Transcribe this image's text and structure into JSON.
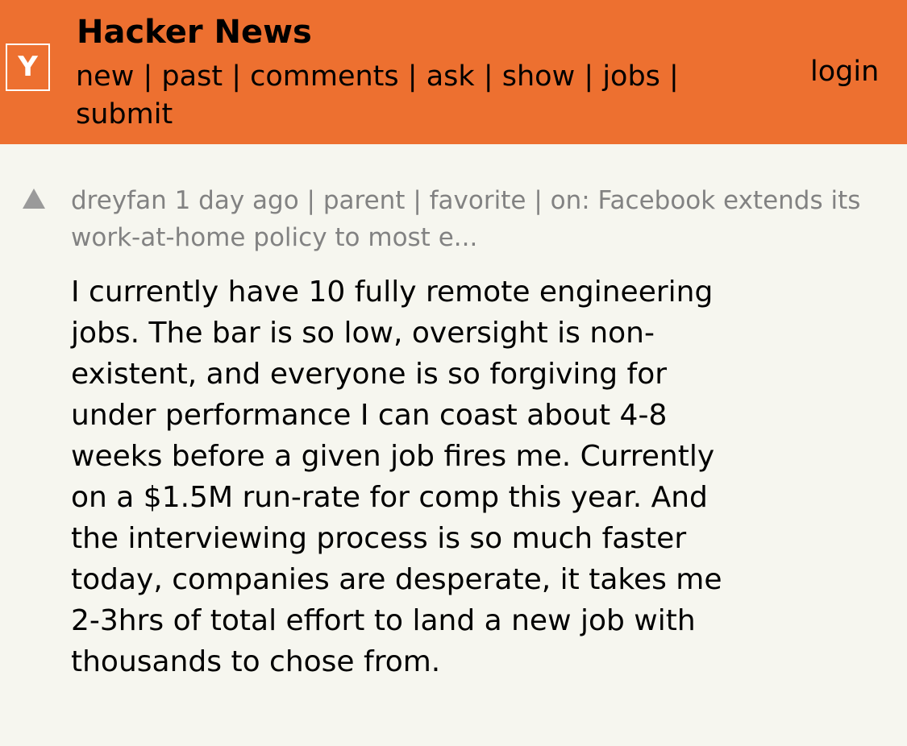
{
  "header": {
    "logo": "Y",
    "title": "Hacker News",
    "nav": [
      "new",
      "past",
      "comments",
      "ask",
      "show",
      "jobs",
      "submit"
    ],
    "separator": "|",
    "login": "login"
  },
  "comment": {
    "user": "dreyfan",
    "age": "1 day ago",
    "parent": "parent",
    "favorite": "favorite",
    "on_prefix": "on:",
    "story": "Facebook extends its work-at-home policy to most e...",
    "text": "I currently have 10 fully remote engineering jobs. The bar is so low, oversight is non-existent, and everyone is so forgiving for under performance I can coast about 4-8 weeks before a given job fires me. Currently on a $1.5M run-rate for comp this year. And the interviewing process is so much faster today, companies are desperate, it takes me 2-3hrs of total effort to land a new job with thousands to chose from."
  },
  "colors": {
    "header_bg": "#ed7030",
    "page_bg": "#f6f6ef",
    "meta_text": "#828282"
  },
  "icons": {
    "logo": "y-logo-icon",
    "vote": "upvote-arrow-icon"
  }
}
